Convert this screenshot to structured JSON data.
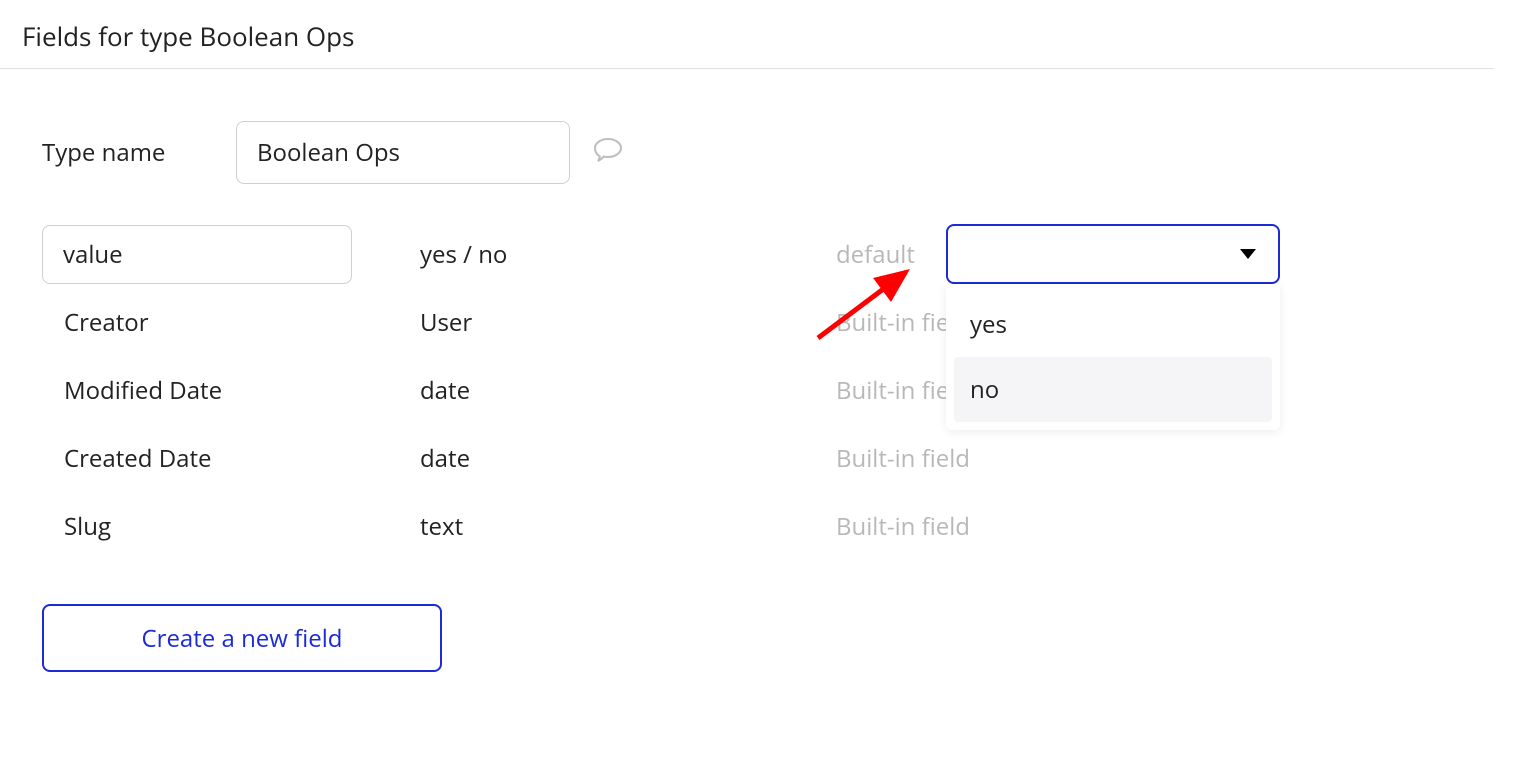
{
  "page_title": "Fields for type Boolean Ops",
  "type_name_label": "Type name",
  "type_name_value": "Boolean Ops",
  "custom_field": {
    "name": "value",
    "type": "yes / no",
    "default_label": "default",
    "default_value": "",
    "options": {
      "yes": "yes",
      "no": "no"
    }
  },
  "builtin_fields": [
    {
      "name": "Creator",
      "type": "User",
      "label": "Built-in field"
    },
    {
      "name": "Modified Date",
      "type": "date",
      "label": "Built-in field"
    },
    {
      "name": "Created Date",
      "type": "date",
      "label": "Built-in field"
    },
    {
      "name": "Slug",
      "type": "text",
      "label": "Built-in field"
    }
  ],
  "create_button": "Create a new field"
}
